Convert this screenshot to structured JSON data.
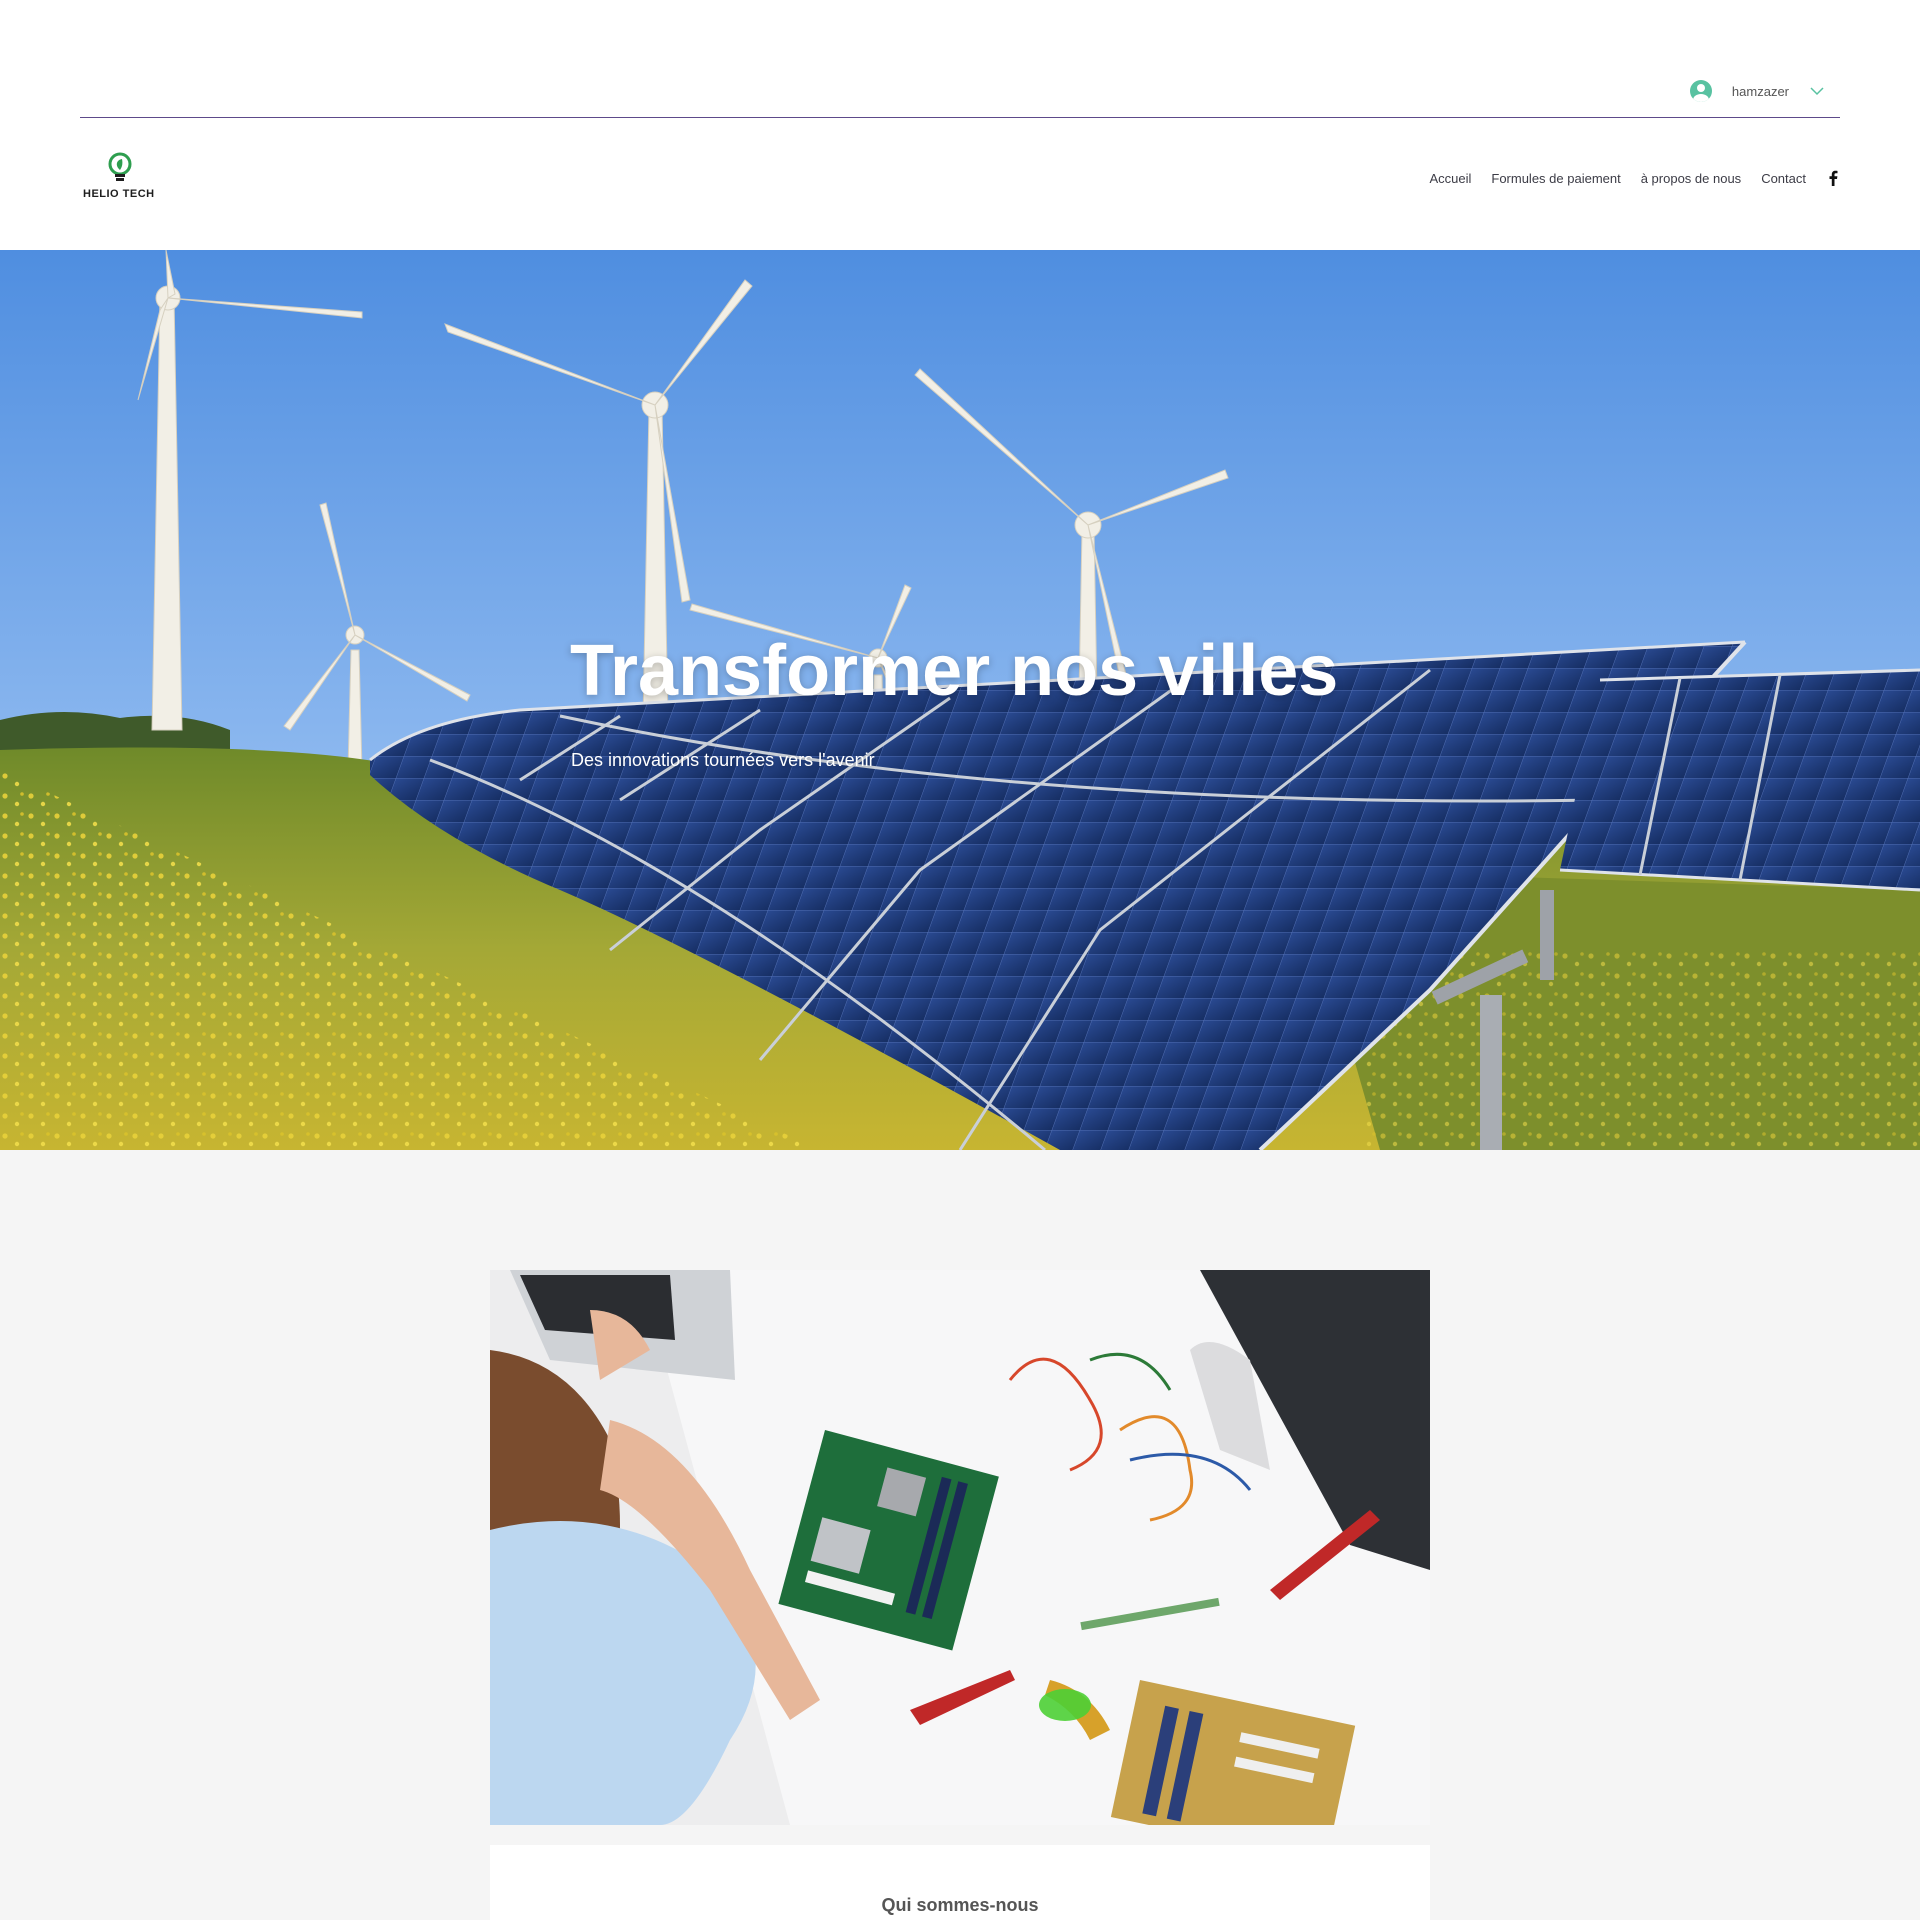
{
  "user": {
    "name": "hamzazer",
    "avatar_color": "#58c2a1"
  },
  "brand": {
    "name": "HELIO TECH",
    "accent": "#2e9e4f"
  },
  "nav": {
    "items": [
      {
        "label": "Accueil"
      },
      {
        "label": "Formules de paiement"
      },
      {
        "label": "à propos de nous"
      },
      {
        "label": "Contact"
      }
    ],
    "social_icon": "facebook-icon"
  },
  "hero": {
    "title": "Transformer nos villes",
    "subtitle": "Des innovations tournées vers l'avenir"
  },
  "about": {
    "heading": "Qui sommes-nous"
  },
  "colors": {
    "header_rule": "#5d4a8a",
    "page_bg": "#f5f5f5",
    "sky": "#6fa3e6",
    "field": "#9aa63a",
    "panel": "#1f3c7a"
  }
}
